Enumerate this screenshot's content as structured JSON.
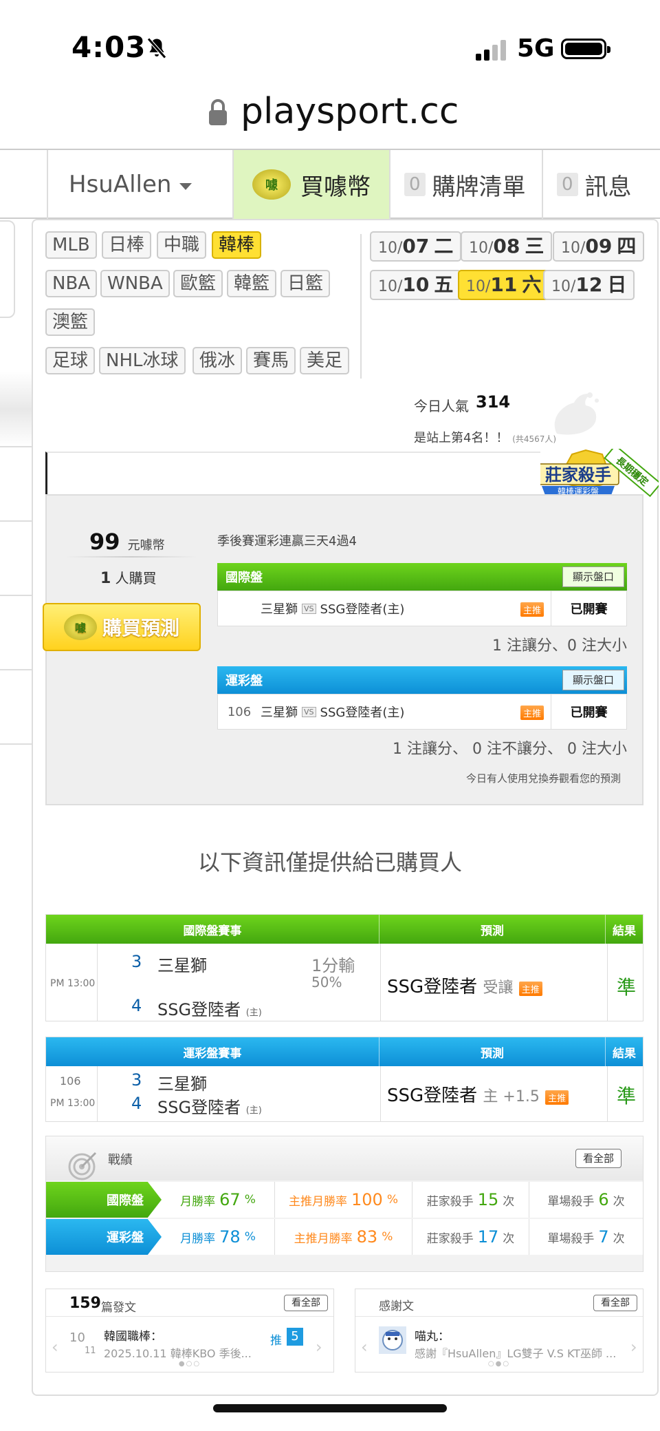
{
  "status": {
    "time": "4:03",
    "network": "5G"
  },
  "browser": {
    "url": "playsport.cc"
  },
  "nav": {
    "user": "HsuAllen",
    "buy_label": "買噱幣",
    "coin_text": "噱",
    "cart_count": "0",
    "cart_label": "購牌清單",
    "msg_count": "0",
    "msg_label": "訊息"
  },
  "sports": {
    "row1": [
      "MLB",
      "日棒",
      "中職",
      "韓棒"
    ],
    "row2": [
      "NBA",
      "WNBA",
      "歐籃",
      "韓籃",
      "日籃"
    ],
    "row3": [
      "澳籃"
    ],
    "row4": [
      "足球",
      "NHL冰球",
      "俄冰",
      "賽馬",
      "美足"
    ],
    "selected": "韓棒"
  },
  "dates": [
    {
      "md": "10/",
      "d": "07",
      "w": "二"
    },
    {
      "md": "10/",
      "d": "08",
      "w": "三"
    },
    {
      "md": "10/",
      "d": "09",
      "w": "四"
    },
    {
      "md": "10/",
      "d": "10",
      "w": "五"
    },
    {
      "md": "10/",
      "d": "11",
      "w": "六"
    },
    {
      "md": "10/",
      "d": "12",
      "w": "日"
    }
  ],
  "popularity": {
    "label": "今日人氣",
    "value": "314",
    "rank_text": "是站上第4名！！",
    "total_text": "(共4567人)"
  },
  "badge": {
    "title": "莊家殺手",
    "sub": "韓棒運彩盤",
    "ribbon": "長期穩定"
  },
  "purchase": {
    "price": "99",
    "price_unit": "元噱幣",
    "buyer_count": "1",
    "buyer_unit": "人購買",
    "button": "購買預測",
    "coin_text": "噱"
  },
  "streak_text": "季後賽運彩連贏三天4過4",
  "intl": {
    "header": "國際盤",
    "show_button": "顯示盤口",
    "away": "三星獅",
    "vs": "VS",
    "home": "SSG登陸者(主)",
    "tag": "主推",
    "status": "已開賽",
    "summary": "1 注讓分、0 注大小"
  },
  "lottery": {
    "header": "運彩盤",
    "show_button": "顯示盤口",
    "no": "106",
    "away": "三星獅",
    "vs": "VS",
    "home": "SSG登陸者(主)",
    "tag": "主推",
    "status": "已開賽",
    "summary": "1 注讓分、 0 注不讓分、 0 注大小"
  },
  "exchange_note": "今日有人使用兌換券觀看您的預測",
  "info_message": "以下資訊僅提供給已購買人",
  "intl_result": {
    "headers": [
      "國際盤賽事",
      "預測",
      "結果"
    ],
    "time": "PM 13:00",
    "away_score": "3",
    "away": "三星獅",
    "home_score": "4",
    "home": "SSG登陸者",
    "home_tag": "(主)",
    "line": "1分輸",
    "line_pct": "50%",
    "pick": "SSG登陸者",
    "pick_type": "受讓",
    "pick_tag": "主推",
    "result": "準"
  },
  "lottery_result": {
    "headers": [
      "運彩盤賽事",
      "預測",
      "結果"
    ],
    "no": "106",
    "time": "PM 13:00",
    "away_score": "3",
    "away": "三星獅",
    "home_score": "4",
    "home": "SSG登陸者",
    "home_tag": "(主)",
    "pick": "SSG登陸者",
    "pick_type": "主 +1.5",
    "pick_tag": "主推",
    "result": "準"
  },
  "performance": {
    "title": "戰績",
    "all_button": "看全部",
    "rows": [
      {
        "label": "國際盤",
        "m_lbl": "月勝率",
        "m_val": "67",
        "o_lbl": "主推月勝率",
        "o_val": "100",
        "pct": "%",
        "k_lbl": "莊家殺手",
        "k_val": "15",
        "s_lbl": "單場殺手",
        "s_val": "6",
        "times": "次"
      },
      {
        "label": "運彩盤",
        "m_lbl": "月勝率",
        "m_val": "78",
        "o_lbl": "主推月勝率",
        "o_val": "83",
        "pct": "%",
        "k_lbl": "莊家殺手",
        "k_val": "17",
        "s_lbl": "單場殺手",
        "s_val": "7",
        "times": "次"
      }
    ]
  },
  "posts": {
    "count": "159",
    "label": "篇發文",
    "all_button": "看全部",
    "date_top": "10",
    "date_bottom": "11",
    "category": "韓國職棒：",
    "preview": "2025.10.11 韓棒KBO 季後...",
    "push_label": "推",
    "push_count": "5"
  },
  "thanks": {
    "label": "感謝文",
    "all_button": "看全部",
    "author": "喵丸：",
    "preview": "感謝『HsuAllen』LG雙子 V.S KT巫師 ..."
  }
}
